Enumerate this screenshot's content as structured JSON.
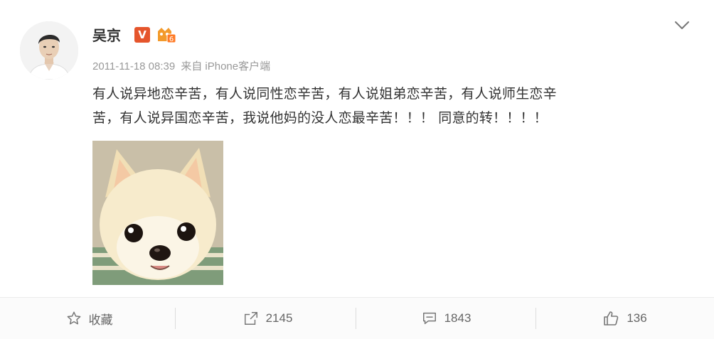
{
  "post": {
    "author": "吴京",
    "verified_badge": "V",
    "level_badge": "6",
    "timestamp": "2011-11-18 08:39",
    "source_prefix": "来自",
    "source": "iPhone客户端",
    "text_line1": "有人说异地恋辛苦，有人说同性恋辛苦，有人说姐弟恋辛苦，有人说师生恋辛",
    "text_line2": "苦，有人说异国恋辛苦，我说他妈的没人恋最辛苦！！！ 同意的转！！！！"
  },
  "actions": {
    "favorite_label": "收藏",
    "repost_count": "2145",
    "comment_count": "1843",
    "like_count": "136"
  },
  "colors": {
    "verified": "#e5552c",
    "level": "#f39a2b",
    "meta": "#999999",
    "text": "#333333"
  },
  "icons": {
    "expand": "chevron-down-icon",
    "favorite": "star-icon",
    "repost": "repost-icon",
    "comment": "comment-icon",
    "like": "thumbs-up-icon"
  }
}
